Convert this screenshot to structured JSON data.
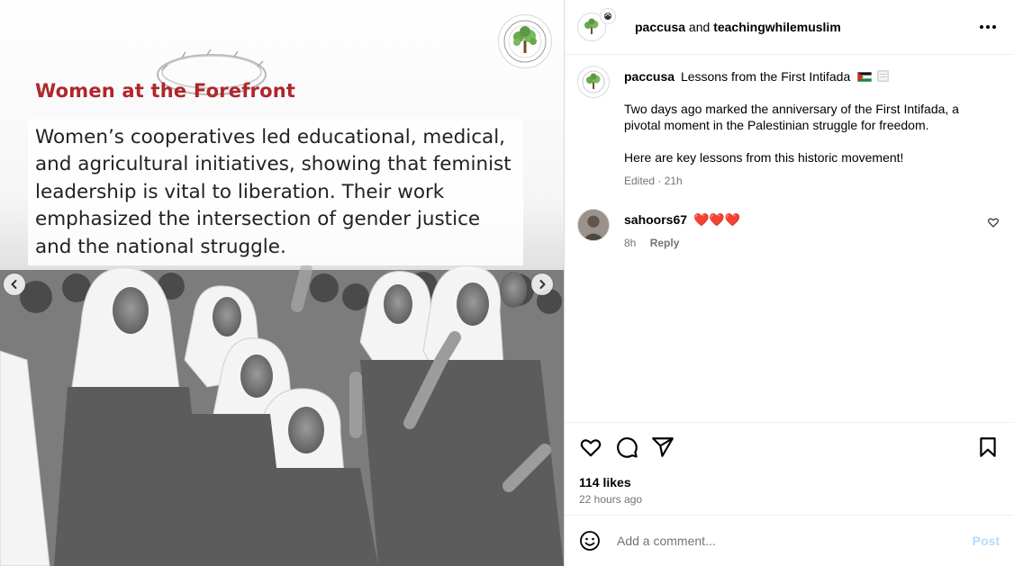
{
  "slide": {
    "title": "Women at the Forefront",
    "body": "Women’s cooperatives led educational, medical, and agricultural initiatives, showing that feminist leadership is vital to liberation. Their work emphasized the intersection of gender justice and the national struggle.",
    "logo_icon": "olive-tree-logo-icon",
    "prev_icon": "chevron-left-icon",
    "next_icon": "chevron-right-icon"
  },
  "header": {
    "user_primary": "paccusa",
    "connector": " and ",
    "user_secondary": "teachingwhilemuslim",
    "more_icon": "more-horizontal-icon"
  },
  "caption": {
    "username": "paccusa",
    "title": "Lessons from the First Intifada",
    "paragraph1": "Two days ago marked the anniversary of the First Intifada, a pivotal moment in the Palestinian struggle for freedom.",
    "paragraph2": "Here are key lessons from this historic movement!",
    "meta": "Edited · 21h"
  },
  "comment": {
    "username": "sahoors67",
    "text": "❤️❤️❤️",
    "time": "8h",
    "reply_label": "Reply",
    "like_icon": "heart-outline-icon"
  },
  "actions": {
    "like_icon": "heart-icon",
    "comment_icon": "comment-icon",
    "share_icon": "share-icon",
    "save_icon": "bookmark-icon",
    "likes": "114 likes",
    "time_ago": "22 hours ago"
  },
  "add_comment": {
    "placeholder": "Add a comment...",
    "post_label": "Post",
    "emoji_icon": "smiley-icon"
  },
  "colors": {
    "accent_title": "#b0262c",
    "post_disabled": "#b3dbff",
    "meta_gray": "#737373",
    "border": "#dbdbdb"
  }
}
